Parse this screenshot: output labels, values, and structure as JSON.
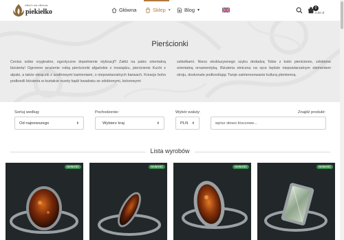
{
  "header": {
    "logo_tagline": "what's not obvious",
    "logo_name": "piekiełko",
    "nav": {
      "home": "Główna",
      "shop": "Sklep",
      "blog": "Blog"
    },
    "cart_count": "0",
    "cart_total": "0,00 zł"
  },
  "hero": {
    "title": "Pierścionki",
    "text_left": "Cenisz sobie oryginalne, egzotyczne dopełnienie stylizacji? Załóż na palec orientalną biżuterię! Ogromne wrażenie robią pierścionki afgańskie z mosiądzu, pierścienie Kuchi z alpaki, a także obrączki z szafirowymi kamieniami, o niepowtarzalnych barwach. Kreacje boho podkreśli biżuteria w kształcie rozety bądź kwadratu ze zdobionymi, kolorowymi",
    "text_right": "szkiełkami. Nieco ekskluzywnego szyku dodadzą Tobie z kolei pierścienie, zdobione orientalną ornamentyką. Biżuteria etniczna na ręce będzie niepowtarzalnym elementem stroju, doskonale podkreślając Twoje zainteresowanie kulturą plemienną."
  },
  "filters": {
    "sort_label": "Sortuj według:",
    "sort_value": "Od najnowszego",
    "origin_label": "Pochodzenie:",
    "origin_value": "Wybierz kraj",
    "currency_label": "Wybór waluty:",
    "currency_value": "PLN",
    "find_label": "Znajdź produkt:",
    "find_placeholder": "wpisz słowo kluczowe..."
  },
  "section": {
    "title": "Lista wyrobów"
  },
  "products": [
    {
      "badge": "NOWOŚĆ"
    },
    {
      "badge": "NOWOŚĆ"
    },
    {
      "badge": "NOWOŚĆ"
    },
    {
      "badge": "NOWOŚĆ"
    }
  ],
  "colors": {
    "accent": "#b07a3f",
    "hero_bg": "#ececec",
    "badge": "#3a8f4d",
    "product_bg": "#22282a"
  },
  "icons": [
    "logo-flame-icon",
    "home-icon",
    "shop-bag-icon",
    "blog-doc-icon",
    "uk-flag-icon",
    "search-icon",
    "cart-icon"
  ]
}
